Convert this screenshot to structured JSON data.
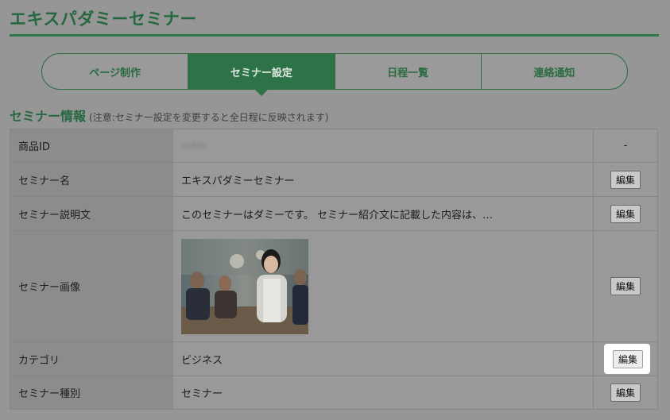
{
  "page": {
    "title": "エキスパダミーセミナー"
  },
  "tabs": [
    {
      "label": "ページ制作",
      "active": false
    },
    {
      "label": "セミナー設定",
      "active": true
    },
    {
      "label": "日程一覧",
      "active": false
    },
    {
      "label": "連絡通知",
      "active": false
    }
  ],
  "section": {
    "heading": "セミナー情報",
    "note": "(注意:セミナー設定を変更すると全日程に反映されます)"
  },
  "rows": {
    "product_id": {
      "label": "商品ID",
      "value": "32845",
      "action": "-"
    },
    "name": {
      "label": "セミナー名",
      "value": "エキスパダミーセミナー",
      "action": "編集"
    },
    "description": {
      "label": "セミナー説明文",
      "value": "このセミナーはダミーです。 セミナー紹介文に記載した内容は、…",
      "action": "編集"
    },
    "image": {
      "label": "セミナー画像",
      "action": "編集",
      "image_alt": "business-people-photo"
    },
    "category": {
      "label": "カテゴリ",
      "value": "ビジネス",
      "action": "編集"
    },
    "type": {
      "label": "セミナー種別",
      "value": "セミナー",
      "action": "編集"
    }
  },
  "colors": {
    "accent": "#2e7248",
    "overlay": "#969696",
    "highlight": "#ffffff"
  }
}
